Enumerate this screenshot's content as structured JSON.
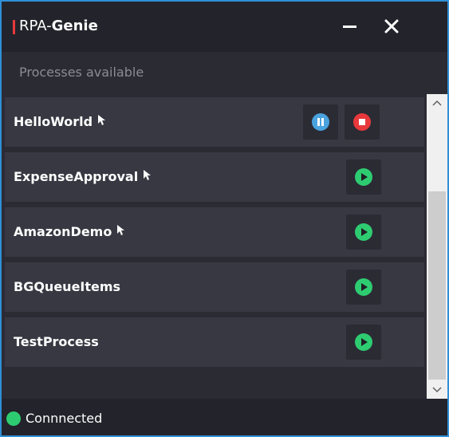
{
  "app": {
    "title_prefix": "RPA-",
    "title_bold": "Genie"
  },
  "section": {
    "title": "Processes available"
  },
  "processes": [
    {
      "name": "HelloWorld",
      "cursor_icon": true,
      "state": "running",
      "actions": [
        "pause-icon",
        "stop-icon"
      ]
    },
    {
      "name": "ExpenseApproval",
      "cursor_icon": true,
      "state": "idle",
      "actions": [
        "play-icon"
      ]
    },
    {
      "name": "AmazonDemo",
      "cursor_icon": true,
      "state": "idle",
      "actions": [
        "play-icon"
      ]
    },
    {
      "name": "BGQueueItems",
      "cursor_icon": false,
      "state": "idle",
      "actions": [
        "play-icon"
      ]
    },
    {
      "name": "TestProcess",
      "cursor_icon": false,
      "state": "idle",
      "actions": [
        "play-icon"
      ]
    }
  ],
  "status": {
    "text": "Connnected",
    "color": "#2ecc71"
  },
  "colors": {
    "accent_red": "#e8383b",
    "pause_blue": "#4aa3df",
    "stop_red": "#e8383b",
    "play_green": "#2ecc71",
    "window_border": "#2f8fd6"
  }
}
